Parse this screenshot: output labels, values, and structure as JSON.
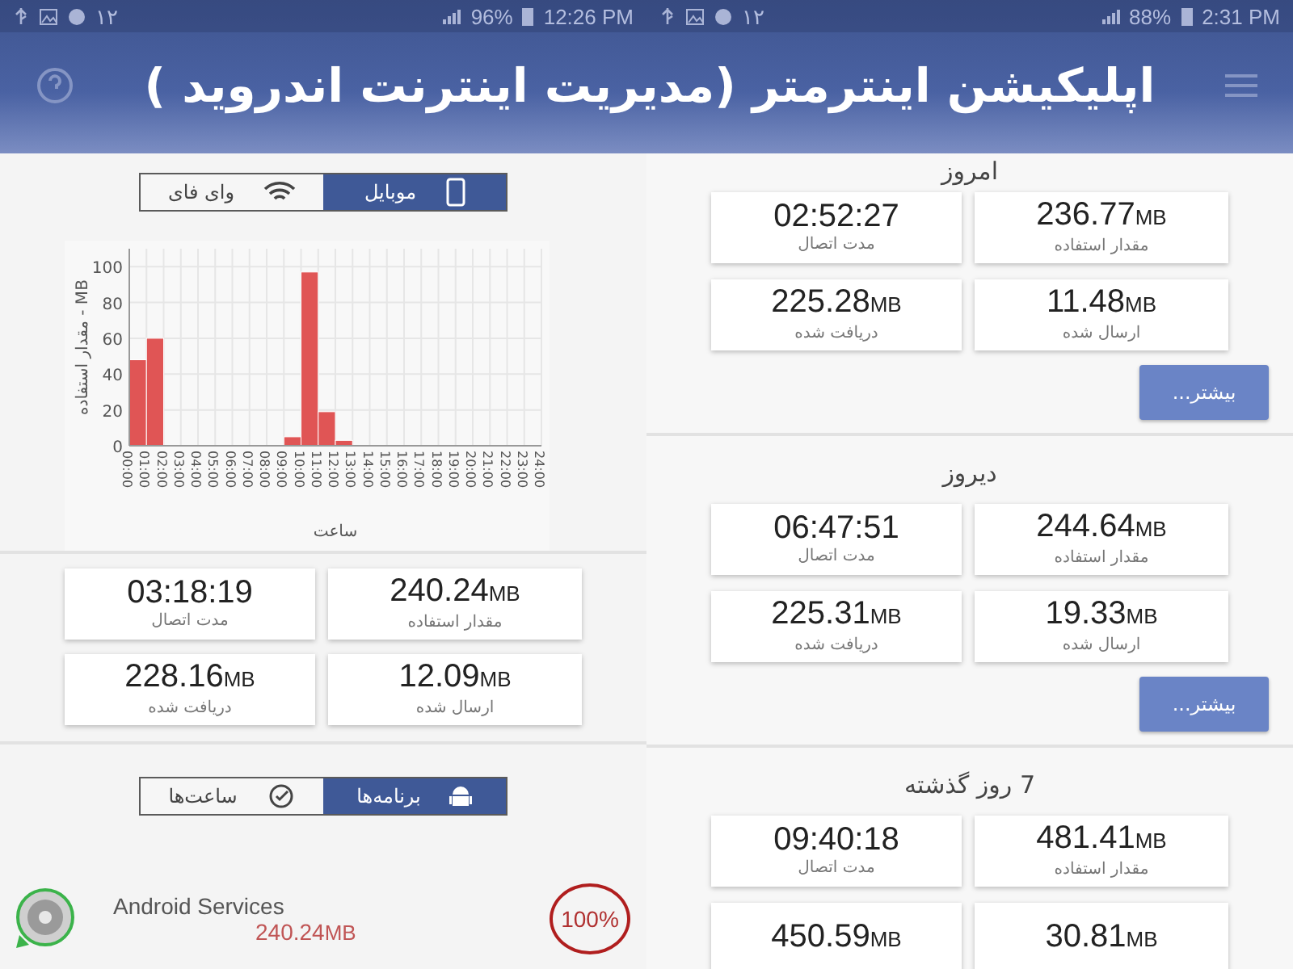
{
  "title": "اپلیکیشن اینترمتر (مدیریت اینترنت اندروید )",
  "left_screen": {
    "status_bar": {
      "notification": "۱۲",
      "battery": "96%",
      "time": "12:26 PM"
    },
    "network_tabs": [
      {
        "label": "موبایل",
        "selected": true
      },
      {
        "label": "وای فای",
        "selected": false
      }
    ],
    "chart_data": {
      "type": "bar",
      "grid": true,
      "xlabel": "ساعت",
      "ylabel": "MB - مقدار استفاده",
      "ylim": [
        0,
        110
      ],
      "yticks": [
        0,
        20,
        40,
        60,
        80,
        100
      ],
      "categories": [
        "00:00",
        "01:00",
        "02:00",
        "03:00",
        "04:00",
        "05:00",
        "06:00",
        "07:00",
        "08:00",
        "09:00",
        "10:00",
        "11:00",
        "12:00",
        "13:00",
        "14:00",
        "15:00",
        "16:00",
        "17:00",
        "18:00",
        "19:00",
        "20:00",
        "21:00",
        "22:00",
        "23:00",
        "24:00"
      ],
      "series": [
        {
          "color": "#e05555",
          "values": [
            48,
            60,
            0,
            0,
            0,
            0,
            0,
            0,
            0,
            5,
            97,
            19,
            3,
            0,
            0,
            0,
            0,
            0,
            0,
            0,
            0,
            0,
            0,
            0,
            null
          ]
        }
      ]
    },
    "stats": [
      {
        "value": "240.24",
        "unit": "MB",
        "label": "مقدار استفاده"
      },
      {
        "value": "03:18:19",
        "label": "مدت اتصال"
      },
      {
        "value": "12.09",
        "unit": "MB",
        "label": "ارسال شده"
      },
      {
        "value": "228.16",
        "unit": "MB",
        "label": "دریافت شده"
      }
    ],
    "view_tabs": [
      {
        "label": "برنامه‌ها",
        "selected": true
      },
      {
        "label": "ساعت‌ها",
        "selected": false
      }
    ],
    "apps": [
      {
        "name": "Android Services",
        "value": "240.24",
        "unit": "MB",
        "percent": "100%"
      }
    ]
  },
  "right_screen": {
    "status_bar": {
      "notification": "۱۲",
      "battery": "88%",
      "time": "2:31 PM"
    },
    "sections": [
      {
        "heading": "امروز",
        "stats": [
          {
            "value": "236.77",
            "unit": "MB",
            "label": "مقدار استفاده"
          },
          {
            "value": "02:52:27",
            "label": "مدت اتصال"
          },
          {
            "value": "11.48",
            "unit": "MB",
            "label": "ارسال شده"
          },
          {
            "value": "225.28",
            "unit": "MB",
            "label": "دریافت شده"
          }
        ],
        "button": "بیشتر..."
      },
      {
        "heading": "دیروز",
        "stats": [
          {
            "value": "244.64",
            "unit": "MB",
            "label": "مقدار استفاده"
          },
          {
            "value": "06:47:51",
            "label": "مدت اتصال"
          },
          {
            "value": "19.33",
            "unit": "MB",
            "label": "ارسال شده"
          },
          {
            "value": "225.31",
            "unit": "MB",
            "label": "دریافت شده"
          }
        ],
        "button": "بیشتر..."
      },
      {
        "heading": "7 روز گذشته",
        "stats": [
          {
            "value": "481.41",
            "unit": "MB",
            "label": "مقدار استفاده"
          },
          {
            "value": "09:40:18",
            "label": "مدت اتصال"
          },
          {
            "value": "30.81",
            "unit": "MB"
          },
          {
            "value": "450.59",
            "unit": "MB"
          }
        ]
      }
    ]
  }
}
